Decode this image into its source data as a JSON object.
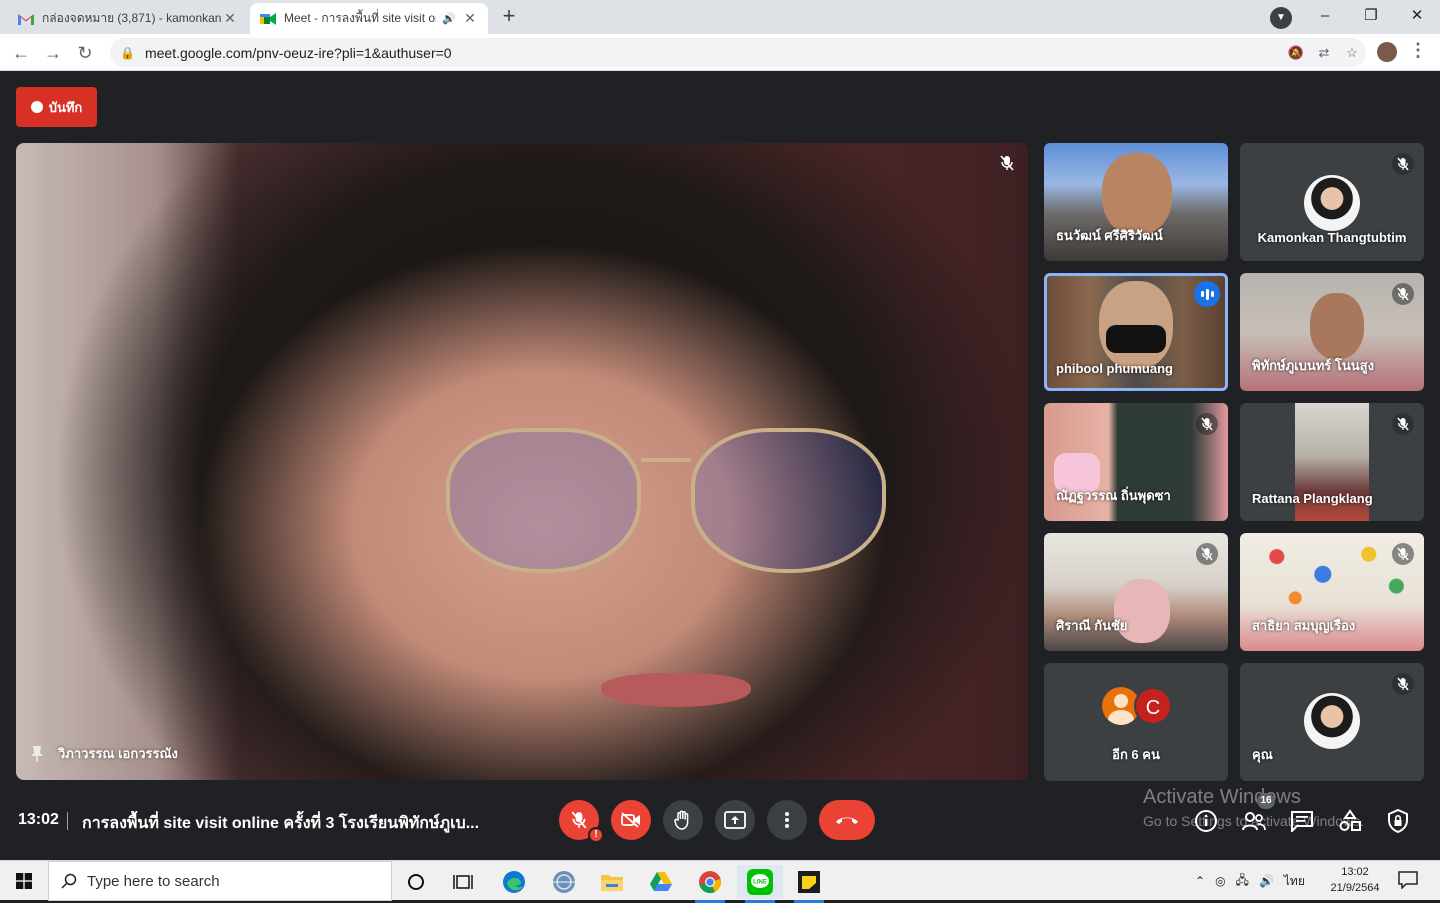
{
  "browser": {
    "tabs": [
      {
        "title": "กล่องจดหมาย (3,871) - kamonkan.t",
        "favicon": "gmail-icon",
        "active": false
      },
      {
        "title": "Meet - การลงพื้นที่ site visit on",
        "favicon": "meet-icon",
        "active": true
      }
    ],
    "url": "meet.google.com/pnv-oeuz-ire?pli=1&authuser=0",
    "new_tab_glyph": "+",
    "window_controls": [
      "–",
      "❐",
      "✕"
    ]
  },
  "meet": {
    "record_label": "บันทึก",
    "main_speaker": {
      "name": "วิภาวรรณ เอกวรรณัง",
      "muted": true
    },
    "participants": [
      {
        "name": "ธนวัฒน์ ศรีศิริวัฒน์",
        "muted": false,
        "speaking": false,
        "kind": "video"
      },
      {
        "name": "Kamonkan Thangtubtim",
        "muted": true,
        "speaking": false,
        "kind": "avatar"
      },
      {
        "name": "phibool phumuang",
        "muted": false,
        "speaking": true,
        "kind": "video"
      },
      {
        "name": "พิทักษ์ภูเบนทร์ โนนสูง",
        "muted": true,
        "speaking": false,
        "kind": "video"
      },
      {
        "name": "ณัฏฐวรรณ ถิ่นพุดซา",
        "muted": true,
        "speaking": false,
        "kind": "video"
      },
      {
        "name": "Rattana Plangklang",
        "muted": true,
        "speaking": false,
        "kind": "video"
      },
      {
        "name": "ศิราณี กันชัย",
        "muted": true,
        "speaking": false,
        "kind": "video"
      },
      {
        "name": "สาธิยา สมบุญเรือง",
        "muted": true,
        "speaking": false,
        "kind": "video"
      },
      {
        "name": "อีก 6 คน",
        "muted": false,
        "speaking": false,
        "kind": "more",
        "avatar_letter": "C"
      },
      {
        "name": "คุณ",
        "muted": true,
        "speaking": false,
        "kind": "avatar"
      }
    ],
    "time": "13:02",
    "meeting_title": "การลงพื้นที่ site visit online ครั้งที่ 3 โรงเรียนพิทักษ์ภูเบ...",
    "people_count": "16",
    "watermark": {
      "line1": "Activate Windows",
      "line2": "Go to Settings to activate Windows."
    }
  },
  "taskbar": {
    "search_placeholder": "Type here to search",
    "apps": [
      "cortana-icon",
      "task-view-icon",
      "edge-icon",
      "network-globe-icon",
      "file-explorer-icon",
      "google-drive-icon",
      "chrome-icon",
      "line-icon",
      "sticky-notes-icon"
    ],
    "language": "ไทย",
    "clock_time": "13:02",
    "clock_date": "21/9/2564"
  },
  "colors": {
    "meet_bg": "#202124",
    "button_gray": "#3c4043",
    "danger_red": "#ea4335",
    "speaking_blue": "#1a73e8"
  }
}
